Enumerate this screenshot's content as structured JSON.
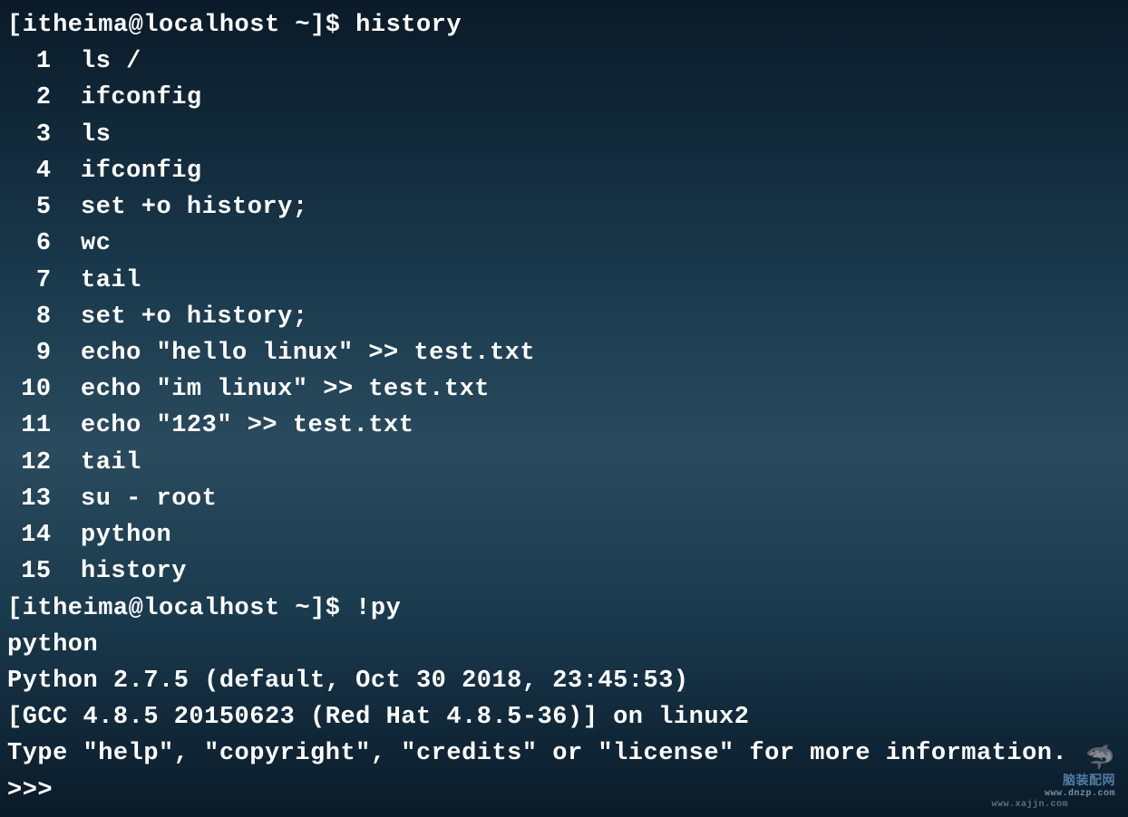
{
  "prompt1": {
    "user": "itheima",
    "host": "localhost",
    "dir": "~",
    "symbol": "$",
    "command": "history"
  },
  "history": [
    {
      "num": "1",
      "cmd": "ls /"
    },
    {
      "num": "2",
      "cmd": "ifconfig"
    },
    {
      "num": "3",
      "cmd": "ls"
    },
    {
      "num": "4",
      "cmd": "ifconfig"
    },
    {
      "num": "5",
      "cmd": "set +o history;"
    },
    {
      "num": "6",
      "cmd": "wc"
    },
    {
      "num": "7",
      "cmd": "tail"
    },
    {
      "num": "8",
      "cmd": "set +o history;"
    },
    {
      "num": "9",
      "cmd": "echo \"hello linux\" >> test.txt"
    },
    {
      "num": "10",
      "cmd": "echo \"im linux\" >> test.txt"
    },
    {
      "num": "11",
      "cmd": "echo \"123\" >> test.txt"
    },
    {
      "num": "12",
      "cmd": "tail"
    },
    {
      "num": "13",
      "cmd": "su - root"
    },
    {
      "num": "14",
      "cmd": "python"
    },
    {
      "num": "15",
      "cmd": "history"
    }
  ],
  "prompt2": {
    "user": "itheima",
    "host": "localhost",
    "dir": "~",
    "symbol": "$",
    "command": "!py"
  },
  "output": {
    "line1": "python",
    "line2": "Python 2.7.5 (default, Oct 30 2018, 23:45:53)",
    "line3": "[GCC 4.8.5 20150623 (Red Hat 4.8.5-36)] on linux2",
    "line4": "Type \"help\", \"copyright\", \"credits\" or \"license\" for more information.",
    "pyprompt": ">>>"
  },
  "watermarks": {
    "w1_top": "脑装配网",
    "w1_bottom": "www.dnzp.com",
    "w2": "www.xajjn.com"
  }
}
